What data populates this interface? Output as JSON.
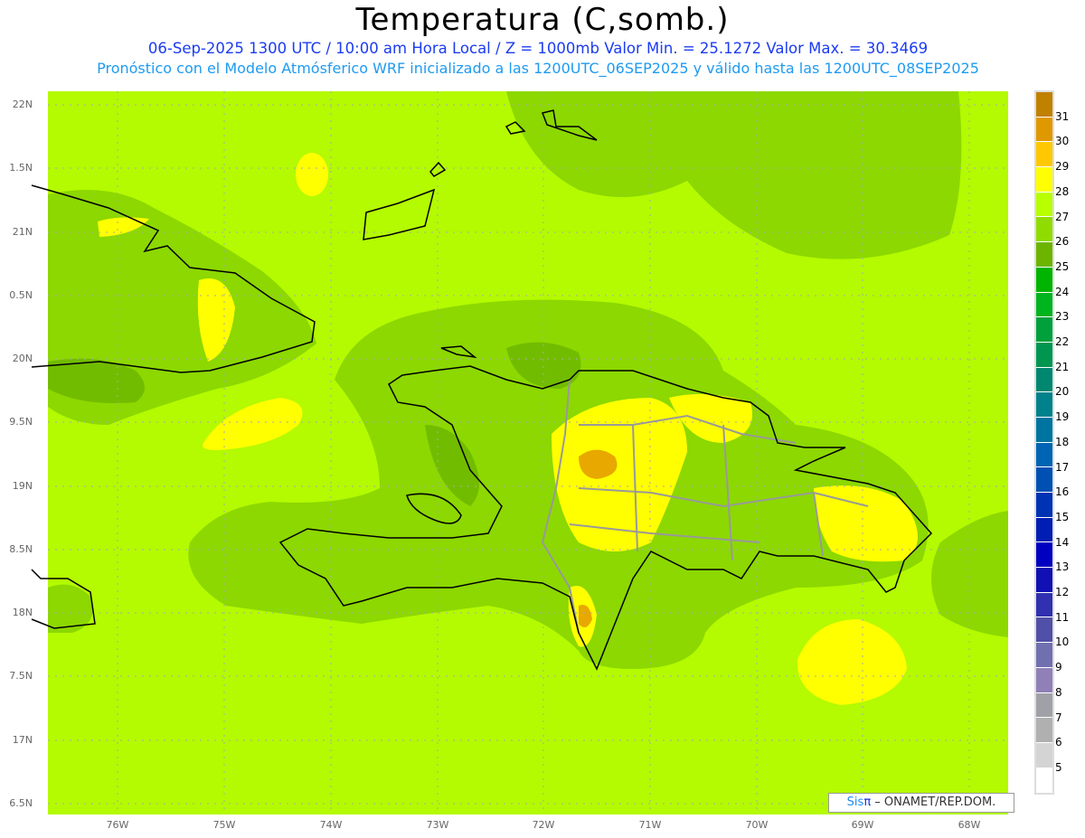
{
  "header": {
    "title": "Temperatura (C,somb.)",
    "line1": "06-Sep-2025 1300 UTC / 10:00 am Hora Local / Z = 1000mb   Valor Min. = 25.1272  Valor Max. = 30.3469",
    "line2": "Pronóstico con el Modelo Atmósferico WRF inicializado a las 1200UTC_06SEP2025 y válido hasta las  1200UTC_08SEP2025"
  },
  "axes": {
    "lat_ticks": [
      "22N",
      "1.5N",
      "21N",
      "0.5N",
      "20N",
      "9.5N",
      "19N",
      "8.5N",
      "18N",
      "7.5N",
      "17N",
      "6.5N"
    ],
    "lon_ticks": [
      "76W",
      "75W",
      "74W",
      "73W",
      "72W",
      "71W",
      "70W",
      "69W",
      "68W"
    ]
  },
  "colorbar": {
    "labels": [
      "31",
      "30",
      "29",
      "28",
      "27",
      "26",
      "25",
      "24",
      "23",
      "22",
      "21",
      "20",
      "19",
      "18",
      "17",
      "16",
      "15",
      "14",
      "13",
      "12",
      "11",
      "10",
      "9",
      "8",
      "7",
      "6",
      "5"
    ],
    "colors": [
      "#c08000",
      "#e09800",
      "#ffc800",
      "#ffff00",
      "#b8ff00",
      "#90dc00",
      "#6cb400",
      "#00b400",
      "#00b41e",
      "#00a03c",
      "#009650",
      "#008770",
      "#00828c",
      "#0074a0",
      "#0064b4",
      "#0050b4",
      "#0032b4",
      "#001eb4",
      "#0000c0",
      "#1010b4",
      "#3030b0",
      "#5050a8",
      "#7070b0",
      "#9080b8",
      "#a0a0a8",
      "#b0b0b0",
      "#d4d4d4",
      "#ffffff"
    ]
  },
  "logo": {
    "sis": "Sis",
    "pi": "π",
    "text": "– ONAMET/REP.DOM."
  },
  "colors": {
    "background_field": "#b4fa00",
    "green_field": "#8cd800",
    "yellow": "#ffff00",
    "orange": "#e8a800"
  }
}
